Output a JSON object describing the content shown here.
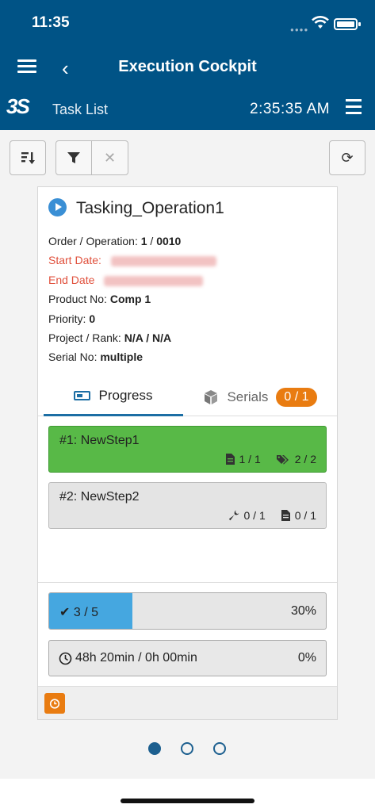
{
  "status_bar": {
    "time": "11:35"
  },
  "nav": {
    "title": "Execution Cockpit"
  },
  "subheader": {
    "section": "Task List",
    "clock": "2:35:35 AM"
  },
  "toolbar": {
    "sort_icon": "sort-icon",
    "filter_icon": "filter-icon",
    "clear_icon": "close-icon",
    "refresh_icon": "refresh-icon"
  },
  "card": {
    "title": "Tasking_Operation1",
    "order_label": "Order / Operation:",
    "order_value": "1",
    "operation_value": "0010",
    "start_label": "Start Date:",
    "end_label": "End Date",
    "product_label": "Product No:",
    "product_value": "Comp 1",
    "priority_label": "Priority:",
    "priority_value": "0",
    "project_label": "Project / Rank:",
    "project_value": "N/A / N/A",
    "serial_label": "Serial No:",
    "serial_value": "multiple",
    "tabs": {
      "progress": "Progress",
      "serials": "Serials",
      "serials_badge": "0 / 1"
    },
    "steps": [
      {
        "name": "#1: NewStep1",
        "docs": "1 / 1",
        "tags": "2 / 2",
        "status_color": "#58b947"
      },
      {
        "name": "#2: NewStep2",
        "tools": "0 / 1",
        "docs": "0 / 1",
        "status_color": "#e4e4e4"
      }
    ],
    "progress": {
      "text": "3 / 5",
      "percent_label": "30%",
      "fraction": 0.3
    },
    "time": {
      "text": "48h 20min / 0h 00min",
      "percent_label": "0%"
    }
  },
  "pager": {
    "pages": 3,
    "active": 0
  },
  "colors": {
    "brand": "#005386",
    "accent": "#e97c11",
    "progress": "#45a7e0"
  }
}
